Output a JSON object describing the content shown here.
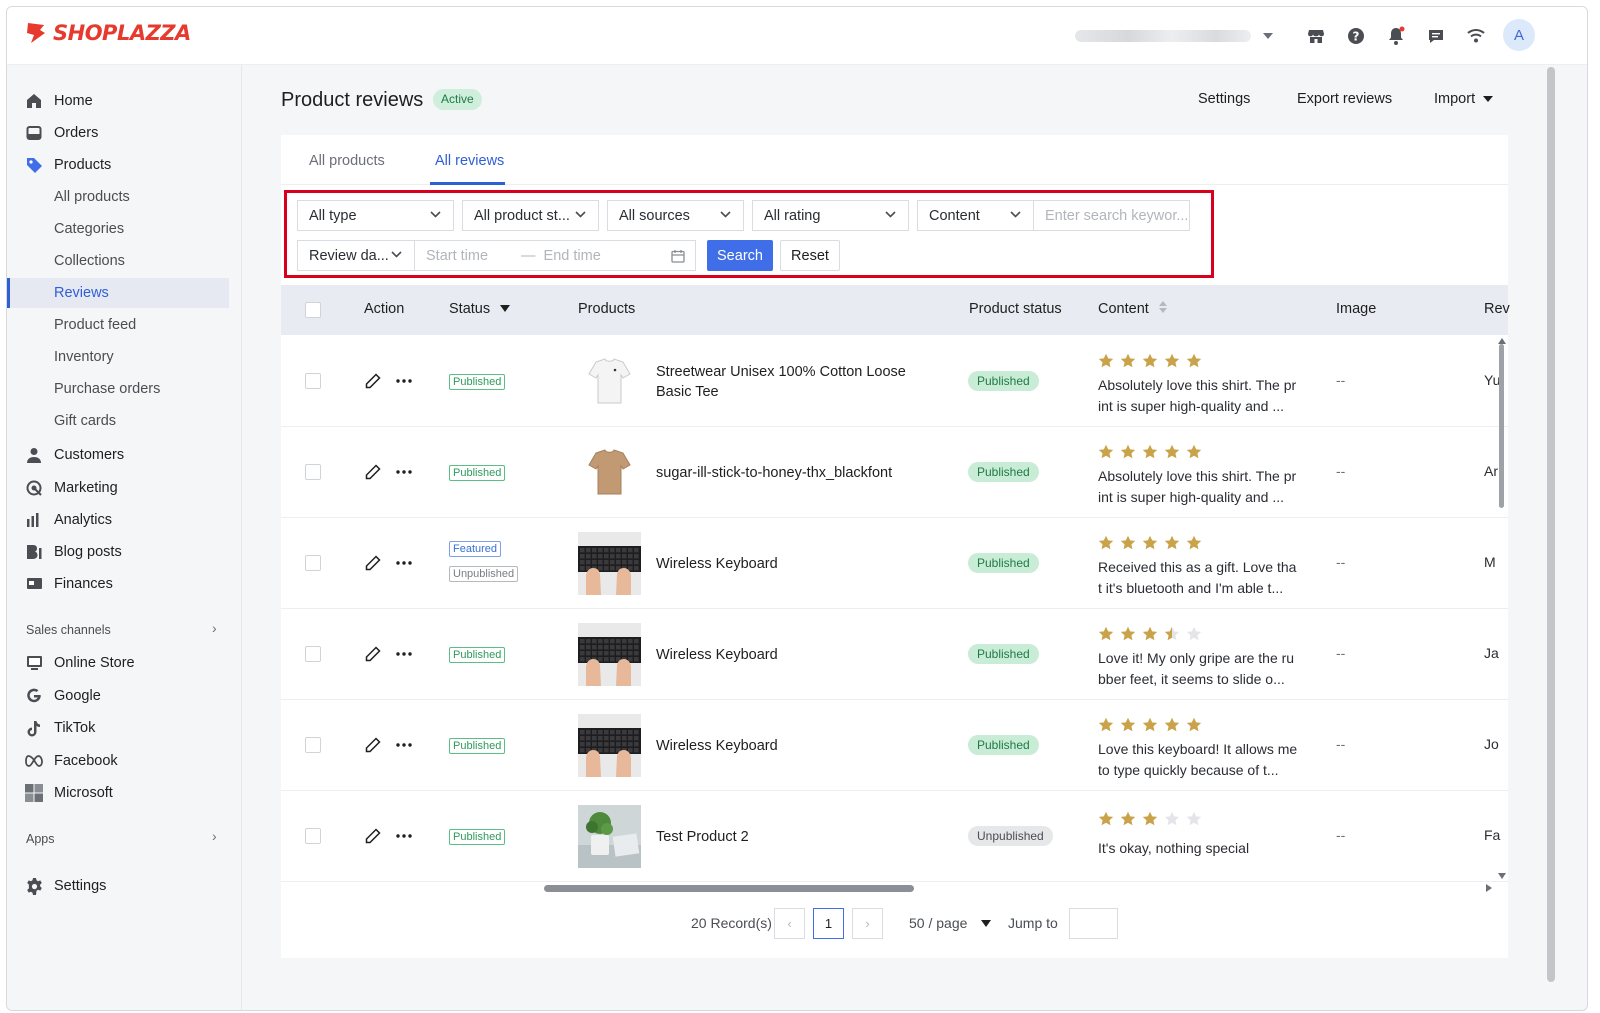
{
  "brand": {
    "name": "SHOPLAZZA",
    "color": "#e63a2e"
  },
  "topbar": {
    "icons": [
      "store-icon",
      "help-icon",
      "bell-icon",
      "message-icon",
      "wifi-icon"
    ],
    "avatar_initial": "A"
  },
  "sidebar": {
    "items": [
      {
        "label": "Home",
        "icon": "home-icon"
      },
      {
        "label": "Orders",
        "icon": "orders-icon"
      },
      {
        "label": "Products",
        "icon": "tag-icon"
      },
      {
        "label": "Customers",
        "icon": "person-icon"
      },
      {
        "label": "Marketing",
        "icon": "marketing-icon"
      },
      {
        "label": "Analytics",
        "icon": "analytics-icon"
      },
      {
        "label": "Blog posts",
        "icon": "blog-icon"
      },
      {
        "label": "Finances",
        "icon": "finances-icon"
      }
    ],
    "product_subitems": [
      "All products",
      "Categories",
      "Collections",
      "Reviews",
      "Product feed",
      "Inventory",
      "Purchase orders",
      "Gift cards"
    ],
    "active_subitem": "Reviews",
    "sales_channels_label": "Sales channels",
    "channels": [
      {
        "label": "Online Store",
        "icon": "online-store-icon"
      },
      {
        "label": "Google",
        "icon": "google-icon"
      },
      {
        "label": "TikTok",
        "icon": "tiktok-icon"
      },
      {
        "label": "Facebook",
        "icon": "meta-icon"
      },
      {
        "label": "Microsoft",
        "icon": "microsoft-icon"
      }
    ],
    "apps_label": "Apps",
    "settings_label": "Settings"
  },
  "header": {
    "title": "Product reviews",
    "badge": "Active",
    "settings": "Settings",
    "export": "Export reviews",
    "import": "Import"
  },
  "tabs": [
    "All products",
    "All reviews"
  ],
  "active_tab": "All reviews",
  "filters": {
    "type": "All type",
    "product_status": "All product st...",
    "sources": "All sources",
    "rating": "All rating",
    "search_field": "Content",
    "search_placeholder": "Enter search keywor...",
    "date_field": "Review da...",
    "start_placeholder": "Start time",
    "range_sep": "—",
    "end_placeholder": "End time",
    "search_button": "Search",
    "reset_button": "Reset"
  },
  "table": {
    "columns": [
      "Action",
      "Status",
      "Products",
      "Product status",
      "Content",
      "Image",
      "Rev"
    ],
    "rows": [
      {
        "statuses": [
          "Published"
        ],
        "product": "Streetwear Unisex 100% Cotton Loose Basic Tee",
        "thumb": "white-tee",
        "product_status": "Published",
        "rating": 5,
        "content": "Absolutely love this shirt. The print is super high-quality and ...",
        "image": "--",
        "reviewer": "Yu"
      },
      {
        "statuses": [
          "Published"
        ],
        "product": "sugar-ill-stick-to-honey-thx_blackfont",
        "thumb": "tan-tee",
        "product_status": "Published",
        "rating": 5,
        "content": "Absolutely love this shirt. The print is super high-quality and ...",
        "image": "--",
        "reviewer": "Ar"
      },
      {
        "statuses": [
          "Featured",
          "Unpublished"
        ],
        "product": "Wireless Keyboard",
        "thumb": "keyboard",
        "product_status": "Published",
        "rating": 5,
        "content": "Received this as a gift. Love that it's bluetooth and I'm able t...",
        "image": "--",
        "reviewer": "M"
      },
      {
        "statuses": [
          "Published"
        ],
        "product": "Wireless Keyboard",
        "thumb": "keyboard",
        "product_status": "Published",
        "rating": 3.5,
        "content": "Love it! My only gripe are the rubber feet, it seems to slide o...",
        "image": "--",
        "reviewer": "Ja"
      },
      {
        "statuses": [
          "Published"
        ],
        "product": "Wireless Keyboard",
        "thumb": "keyboard",
        "product_status": "Published",
        "rating": 5,
        "content": "Love this keyboard! It allows me to type quickly because of t...",
        "image": "--",
        "reviewer": "Jo"
      },
      {
        "statuses": [
          "Published"
        ],
        "product": "Test Product 2",
        "thumb": "plant",
        "product_status": "Unpublished",
        "rating": 3,
        "content": "It's okay, nothing special",
        "image": "--",
        "reviewer": "Fa"
      }
    ]
  },
  "pagination": {
    "records": "20 Record(s)",
    "current_page": "1",
    "page_size": "50 / page",
    "jump_label": "Jump to"
  },
  "colors": {
    "accent": "#3f6ee8",
    "star": "#c9a24a",
    "highlight": "#d9001b"
  }
}
